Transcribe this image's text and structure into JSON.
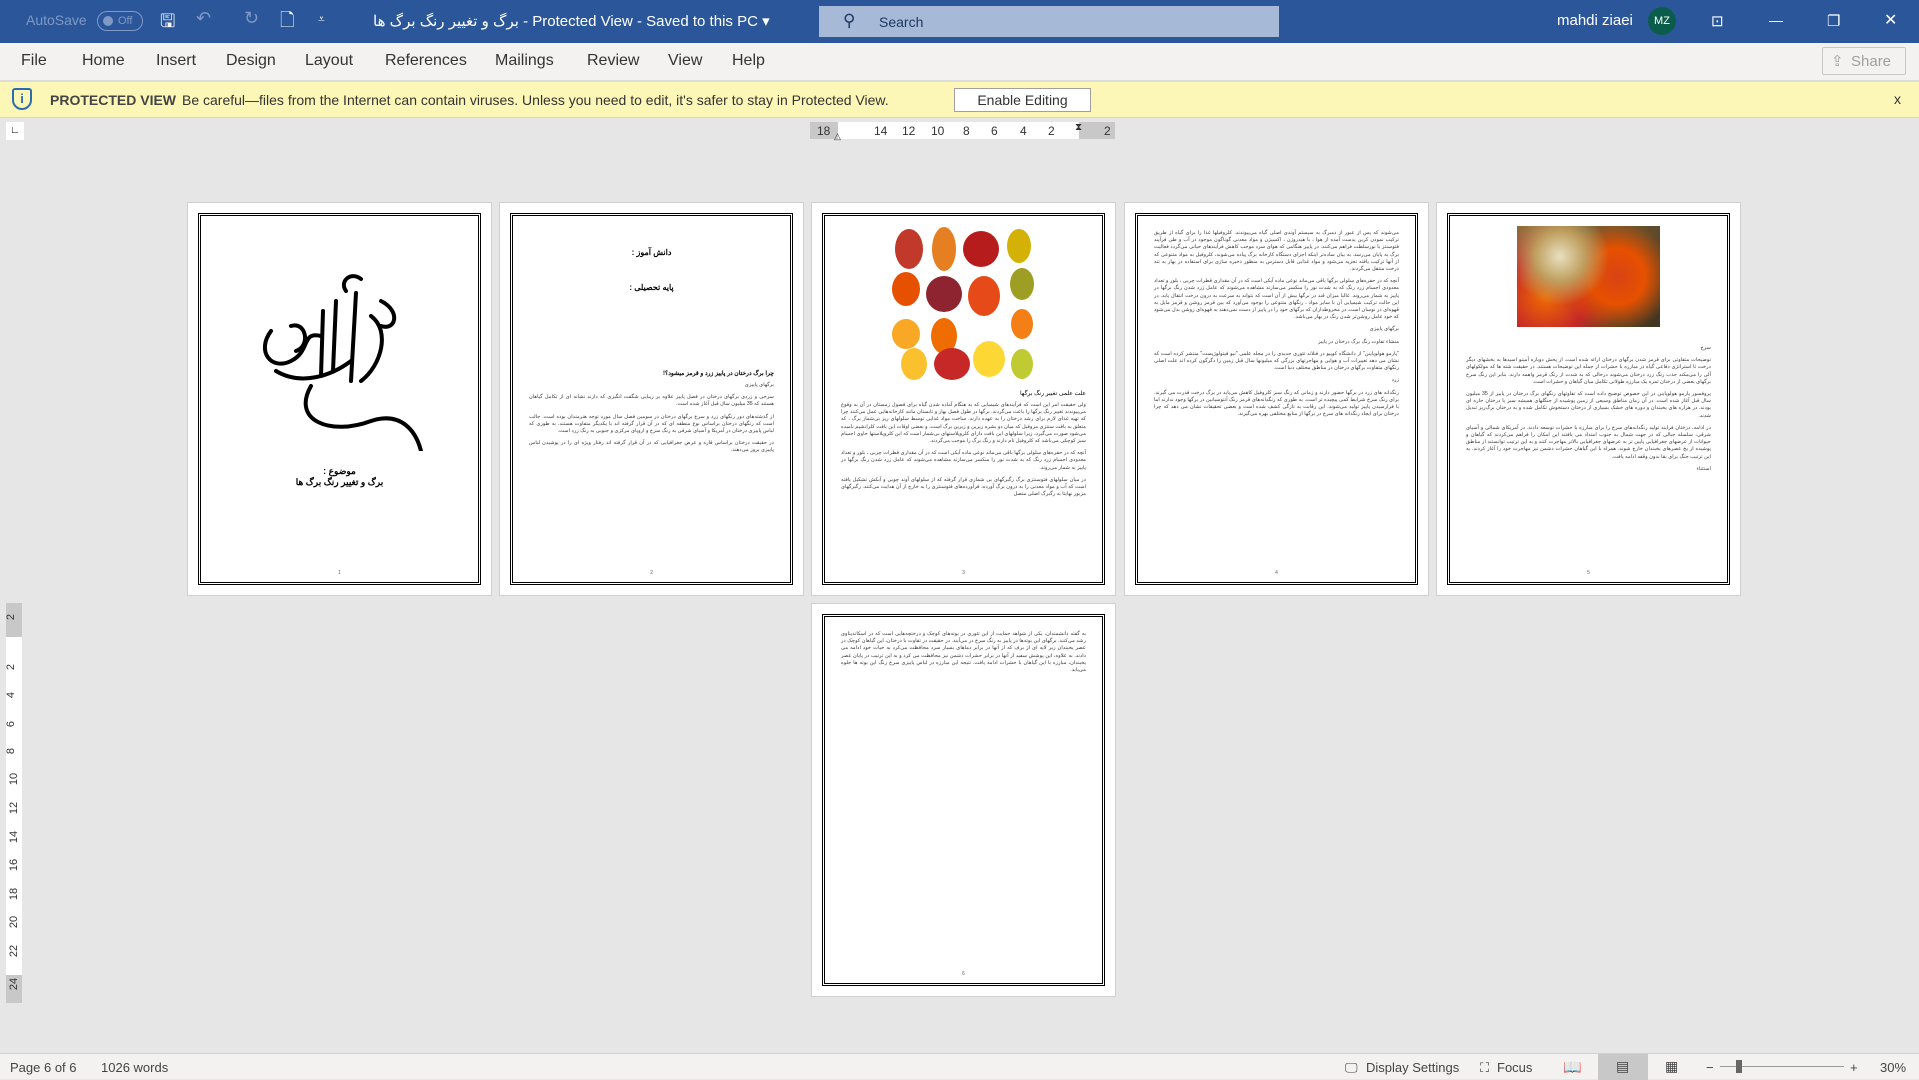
{
  "titlebar": {
    "autosave": "AutoSave",
    "autosave_state": "Off",
    "title": "برگ و تغییر رنگ برگ ها  -  Protected View  -  Saved to this PC ▾",
    "search_placeholder": "Search",
    "user": "mahdi ziaei",
    "initials": "MZ"
  },
  "ribbon": {
    "tabs": [
      "File",
      "Home",
      "Insert",
      "Design",
      "Layout",
      "References",
      "Mailings",
      "Review",
      "View",
      "Help"
    ],
    "share": "Share"
  },
  "protected": {
    "label": "PROTECTED VIEW",
    "message": "Be careful—files from the Internet can contain viruses. Unless you need to edit, it's safer to stay in Protected View.",
    "button": "Enable Editing",
    "close": "x"
  },
  "ruler": {
    "h": [
      "18",
      "14",
      "12",
      "10",
      "8",
      "6",
      "4",
      "2",
      "2"
    ],
    "v": [
      "2",
      "2",
      "4",
      "6",
      "8",
      "10",
      "12",
      "14",
      "16",
      "18",
      "20",
      "22",
      "24"
    ]
  },
  "pages": [
    {
      "subject_label": "موضوع :",
      "subject": "برگ و تغییر رنگ برگ ها",
      "num": "1"
    },
    {
      "student": "دانش آموز :",
      "grade": "پایه تحصیلی  :",
      "heading": "چرا برگ درختان در پاییز زرد و قرمز میشود؟!",
      "sub": "برگهای پاییزی",
      "paras": [
        "سرخی و زردی برگهای درختان در فصل پاییز علاوه بر زیبایی شگفت انگیزی که دارند نشانه ای از تکامل گیاهان هستند که 35 میلیون سال قبل آغاز شده است.",
        "از گذشته‌های دور رنگهای زرد و سرخ برگهای درختان در سومین فصل سال مورد توجه هنرمندان بوده است. جالب است که رنگهای درختان براساس نوع منطقه ای که در آن قرار گرفته اند با یکدیگر متفاوت هستند. به طوری که لباس پاییزی درختان در آمریکا و آسیای شرقی به رنگ سرخ و اروپای مرکزی و جنوبی به رنگ زرد است.",
        "در حقیقت درختان براساس قاره و عرض جغرافیایی که در آن قرار گرفته اند رفتار ویژه ای را در پوشیدن لباس پاییزی بروز می‌دهند."
      ],
      "num": "2"
    },
    {
      "heading": "علت علمی تغییر رنگ برگها",
      "paras": [
        "ولی حقیقت امر این است که فرآیندهای شیمیایی که به هنگام آماده شدن گیاه برای فصول زمستان در آن به وقوع می‌پیوندند تغییر رنگ برگها را باعث می‌گردند. برگها در طول فصل بهار و تابستان مانند کارخانه‌هایی عمل می‌کنند چرا که تهیه غذای لازم برای رشد درختان را به عهده دارند. ساخت مواد غذایی توسط سلولهای ریز بی‌شمار برگ ، که متعلق به بافت سنتزی مزوفیل که میان دو بشره زیرین و زبرین برگ است، و بعضی اوقات این بافت کلرانشیم نامیده می‌شود صورت می‌گیرد، زیرا سلولهای این بافت دارای کلروپلاستهای بی‌شمار است که این کلروپلاستها حاوی اجسام سبز کوچکی می‌باشد که کلروفیل نام دارند و رنگ برگ را موجب می‌گردند.",
        "آنچه که در حفره‌های سلولی برگها باقی می‌ماند نوعی ماده آبکی است که در آن مقداری قطرات چربی ، بلور و تعداد معدودی اجسام زرد رنگ که به شدت نور را منکسر می‌سازند مشاهده می‌شوند که عامل زرد شدن رنگ برگها در پاییز به شمار می‌روند.",
        "در میان سلولهای فتوسنتزی برگ رگبرگهای بی شماری قرار گرفته که از سلولهای آوند چوبی و آبکش تشکیل یافته است که آب و مواد معدنی را به درون برگ آورده، فرآورده‌های فتوسنتزی را به خارج از آن هدایت می‌کنند. رگبرگهای مزبور نهایتا به رگبرگ اصلی متصل"
      ],
      "num": "3"
    },
    {
      "paras": [
        "می‌شوند که پس از عبور از دمبرگ به سیستم آوندی اصلی گیاه می‌پیوندند. کلروفیلها غذا را برای گیاه از طریق ترکیب نمودن کربن بدست آمده از هوا ، با هیدروژن ، اکسیژن و مواد معدنی گوناگون موجود در آب و طی فرآیند فتوسنتز با نورسلطت فراهم می‌کنند. در پاییز هنگامی که هوای سرد موجب کاهش فرآیندهای حیاتی می‌گردد فعالیت برگ به پایان می‌رسد. به بیان ساده‌تر اینکه اجزای دستگاه کارخانه برگ پیاده می‌شوند، کلروفیل به مواد متنوعی که از آنها ترکیب یافته تجزیه می‌شود و مواد غذایی قابل دسترس به منظور ذخیره سازی برای استفاده در بهار به تنه درخت منتقل می‌گردند.",
        "آنچه که در حفره‌های سلولی برگها باقی می‌ماند نوعی ماده آبکی است که در آن مقداری قطرات چربی ، بلور و تعداد معدودی اجسام زرد رنگ که به شدت نور را منکسر می‌سازند مشاهده می‌شوند که عامل زرد شدن رنگ برگها در پاییز به شمار می‌روند. غالبا میزان قند در برگها بیش از آن است که بتواند به سرعت به درون درخت انتقال یابد. در این حالت ترکیب شیمیایی آن با سایر مواد ، رنگهای متنوعی را بوجود می‌آورد که بین قرمز روشن و قرمز مایل به قهوه‌ای در نوسان است. در مخروطداران که برگهای خود را در پاییز از دست نمی‌دهند به قهوه‌ای روشن بدل می‌شود که خود عامل روشن‌تر شدن رنگ در بهار می‌باشد."
      ],
      "sub1": "برگهای پاییزی",
      "sub2": "منشاء تفاوت رنگ برگ درختان در پاییز",
      "paras2": [
        "\"پارمو هولوپاینن\" از دانشگاه کوپیو در فنلاند تئوری جدیدی را در مجله علمی \"نیو فیتولوژیست\" منتشر کرده است که نشان می دهد تغییرات آب و هوایی و مهاجرتهای بزرگی که میلیونها سال قبل زمین را دگرگون کرده اند علت اصلی رنگهای متفاوت برگهای درختان در مناطق مختلف دنیا است."
      ],
      "sub3": "زرد",
      "paras3": [
        "رنگدانه های زرد در برگها حضور دارند و زمانی که رنگ سبز کلروفیل کاهش می‌یابد در برگ درخت قدرت می گیرند. برای رنگ سرخ شرایط کمی پیچیده تر است. به طوری که رنگدانه‌های قرمز رنگ آنتوسیانین در برگها وجود ندارند اما با فرارسیدن پاییز تولید می‌شوند. این رقابت به تازگی کشف شده است و بعضی تحقیقات نشان می دهد که چرا درختان برای ایجاد رنگدانه های سرخ در برگها از منابع مختلفی بهره می‌گیرند."
      ],
      "num": "4"
    },
    {
      "sub": "سرخ",
      "paras": [
        "توضیحات متفاوتی برای قرمز شدن برگهای درختان ارائه شده است. از پخش دوباره آمینو اسیدها به بخشهای دیگر درخت تا استراتژی دفاعی گیاه در مبارزه با حشرات از جمله این توضیحات هستند. در حقیقت شته ها که مولکولهای آلی را می‌مکند جذب رنگ زرد درختان می‌شوند درحالی که به شدت از رنگ قرمز واهمه دارند. بنابر این رنگ سرخ برگهای بعضی از درختان ثمره یک مبارزه طولانی تکامل میان گیاهان و حشرات است.",
        "پروفسور پارمو هولوپاینن در این خصوص توضیح داده است که تفاوتهای رنگهای برگ درختان در پاییز از 35 میلیون سال قبل آغاز شده است. در آن زمان مناطق وسیعی از زمین پوشیده از جنگلهای همیشه سبز با درختان حاره ای بودند. در هزاره های یخبندان و دوره های خشک بسیاری از درختان دستخوش تکامل شده و به درختان برگ‌ریز تبدیل شدند.",
        "در ادامه، درختان فرایند تولید رنگدانه‌های سرخ را برای مبارزه با حشرات توسعه دادند. در آمریکای شمالی و آسیای شرقی، سلسله جبالی که در جهت شمال به جنوب امتداد می یافتند این امکان را فراهم می‌کردند که گیاهان و حیوانات از عرضهای جغرافیایی پایین تر به عرضهای جغرافیایی بالاتر مهاجرت کنند و به این ترتیب توانستند از مناطق پوشیده از یخ عصرهای یخبندان خارج شوند. همراه با این گیاهان حشرات دشمن نیز مهاجرت خود را آغاز کردند. به این ترتیب جنگ برای بقا بدون وقفه ادامه یافت."
      ],
      "tail": "استثناء",
      "num": "5"
    },
    {
      "paras": [
        "به گفته دانشمندان، یکی از شواهد حمایت از این تئوری در بوته‌های کوچک و درختچه‌هایی است که در اسکاندیناوی رشد می‌کنند. برگهای این بوته‌ها در پاییز به رنگ سرخ در می‌آیند. در حقیقت در تفاوت با درختان، این گیاهان کوچک در عصر یخبندان زیر لایه ای از برف که از آنها در برابر دماهای بسیار سرد محافظت می‌کرد به حیات خود ادامه می دادند. به علاوه، این پوشش سفید از آنها در برابر حشرات دشمن نیز محافظت می کرد و به این ترتیب در پایان عصر یخبندان، مبارزه با این گیاهان با حشرات ادامه یافت. نتیجه این مبارزه در لباس پاییزی سرخ رنگ این بوته ها جلوه می‌یابد."
      ],
      "num": "6"
    }
  ],
  "status": {
    "page": "Page 6 of 6",
    "words": "1026 words",
    "display_settings": "Display Settings",
    "focus": "Focus",
    "zoom": "30%",
    "zoom_percent": 30
  },
  "colors": {
    "titlebar": "#2b579a",
    "protected_bar": "#fcf7b6",
    "avatar": "#0a5d4a"
  }
}
